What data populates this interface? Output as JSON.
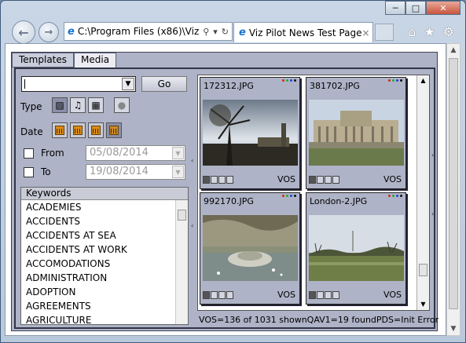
{
  "browser": {
    "address": "C:\\Program Files (x86)\\Viz",
    "tab_title": "Viz Pilot News Test Page",
    "tab_close": "×",
    "win_minimize": "─",
    "win_maximize": "□",
    "win_close": "✕"
  },
  "app": {
    "tabs": [
      {
        "label": "Templates"
      },
      {
        "label": "Media"
      }
    ],
    "search": {
      "value": "",
      "go_label": "Go"
    },
    "type_label": "Type",
    "date_label": "Date",
    "from_label": "From",
    "to_label": "To",
    "from_date": "05/08/2014",
    "to_date": "19/08/2014",
    "keywords": {
      "header": "Keywords",
      "items": [
        "ACADEMIES",
        "ACCIDENTS",
        "ACCIDENTS AT SEA",
        "ACCIDENTS AT WORK",
        "ACCOMODATIONS",
        "ADMINISTRATION",
        "ADOPTION",
        "AGREEMENTS",
        "AGRICULTURE"
      ]
    },
    "media": [
      {
        "name": "172312.JPG",
        "source": "VOS"
      },
      {
        "name": "381702.JPG",
        "source": "VOS"
      },
      {
        "name": "992170.JPG",
        "source": "VOS"
      },
      {
        "name": "London-2.JPG",
        "source": "VOS"
      }
    ],
    "status": {
      "vos": "VOS=136 of 1031 shown",
      "qav": "QAV1=19 found",
      "pds": "PDS=Init Error"
    }
  },
  "colors": {
    "panel": "#aeb3c7",
    "dot_red": "#e02020",
    "dot_green": "#20b020",
    "dot_blue": "#2040e0",
    "dot_black": "#111111"
  }
}
